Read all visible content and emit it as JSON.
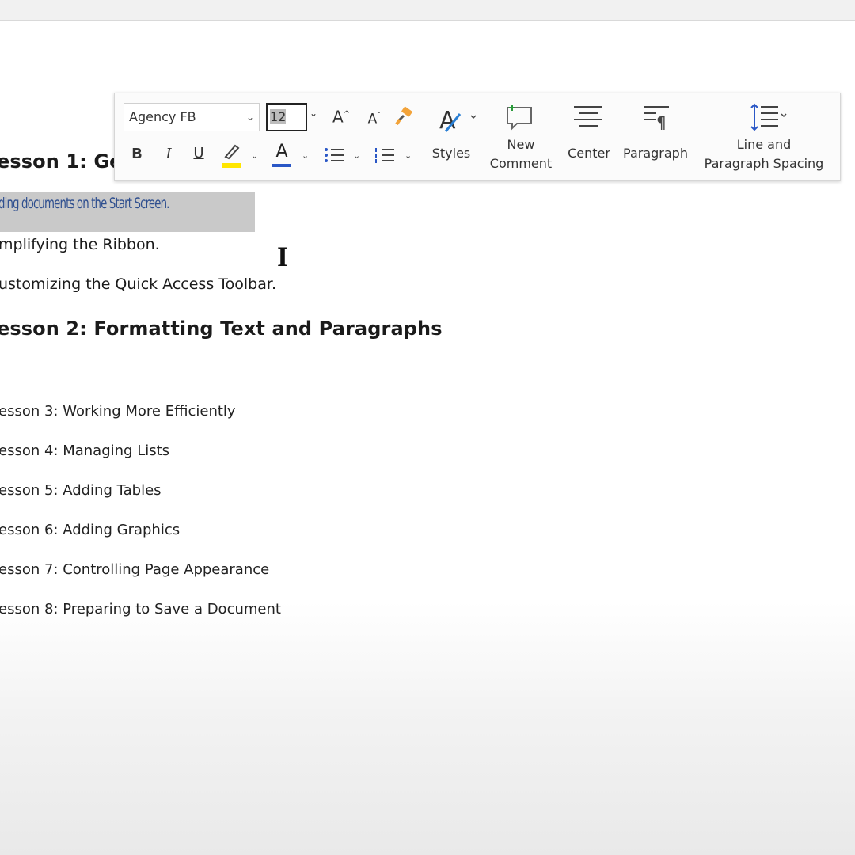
{
  "document": {
    "lesson1_heading": "esson 1: Get",
    "selected_line": "ding documents on the Start Screen.",
    "line_simplifying": "mplifying the Ribbon.",
    "line_customizing": "ustomizing the Quick Access Toolbar.",
    "lesson2_heading": "esson 2: Formatting Text and Paragraphs",
    "lessons": [
      "esson 3: Working More Efficiently",
      "esson 4: Managing Lists",
      "esson 5: Adding Tables",
      "esson 6: Adding Graphics",
      "esson 7: Controlling Page Appearance",
      "esson 8: Preparing to Save a Document"
    ]
  },
  "mini_toolbar": {
    "font_name": "Agency FB",
    "font_size": "12",
    "bold": "B",
    "italic": "I",
    "underline": "U",
    "font_color_glyph": "A",
    "grow_font": "A",
    "shrink_font": "A",
    "styles_label": "Styles",
    "new_comment_label_1": "New",
    "new_comment_label_2": "Comment",
    "center_label": "Center",
    "paragraph_label": "Paragraph",
    "spacing_label_1": "Line and",
    "spacing_label_2": "Paragraph Spacing",
    "highlight_color": "#ffe600",
    "font_color": "#2a57c6"
  },
  "icons": {
    "grow_font": "grow-font-icon",
    "shrink_font": "shrink-font-icon",
    "format_painter": "format-painter-icon",
    "highlight": "highlighter-icon",
    "font_color": "font-color-icon",
    "bullets": "bullet-list-icon",
    "numbering": "numbered-list-icon",
    "styles": "styles-icon",
    "comment": "new-comment-icon",
    "center": "center-align-icon",
    "paragraph": "paragraph-icon",
    "spacing": "line-spacing-icon",
    "cursor": "text-cursor-icon"
  }
}
